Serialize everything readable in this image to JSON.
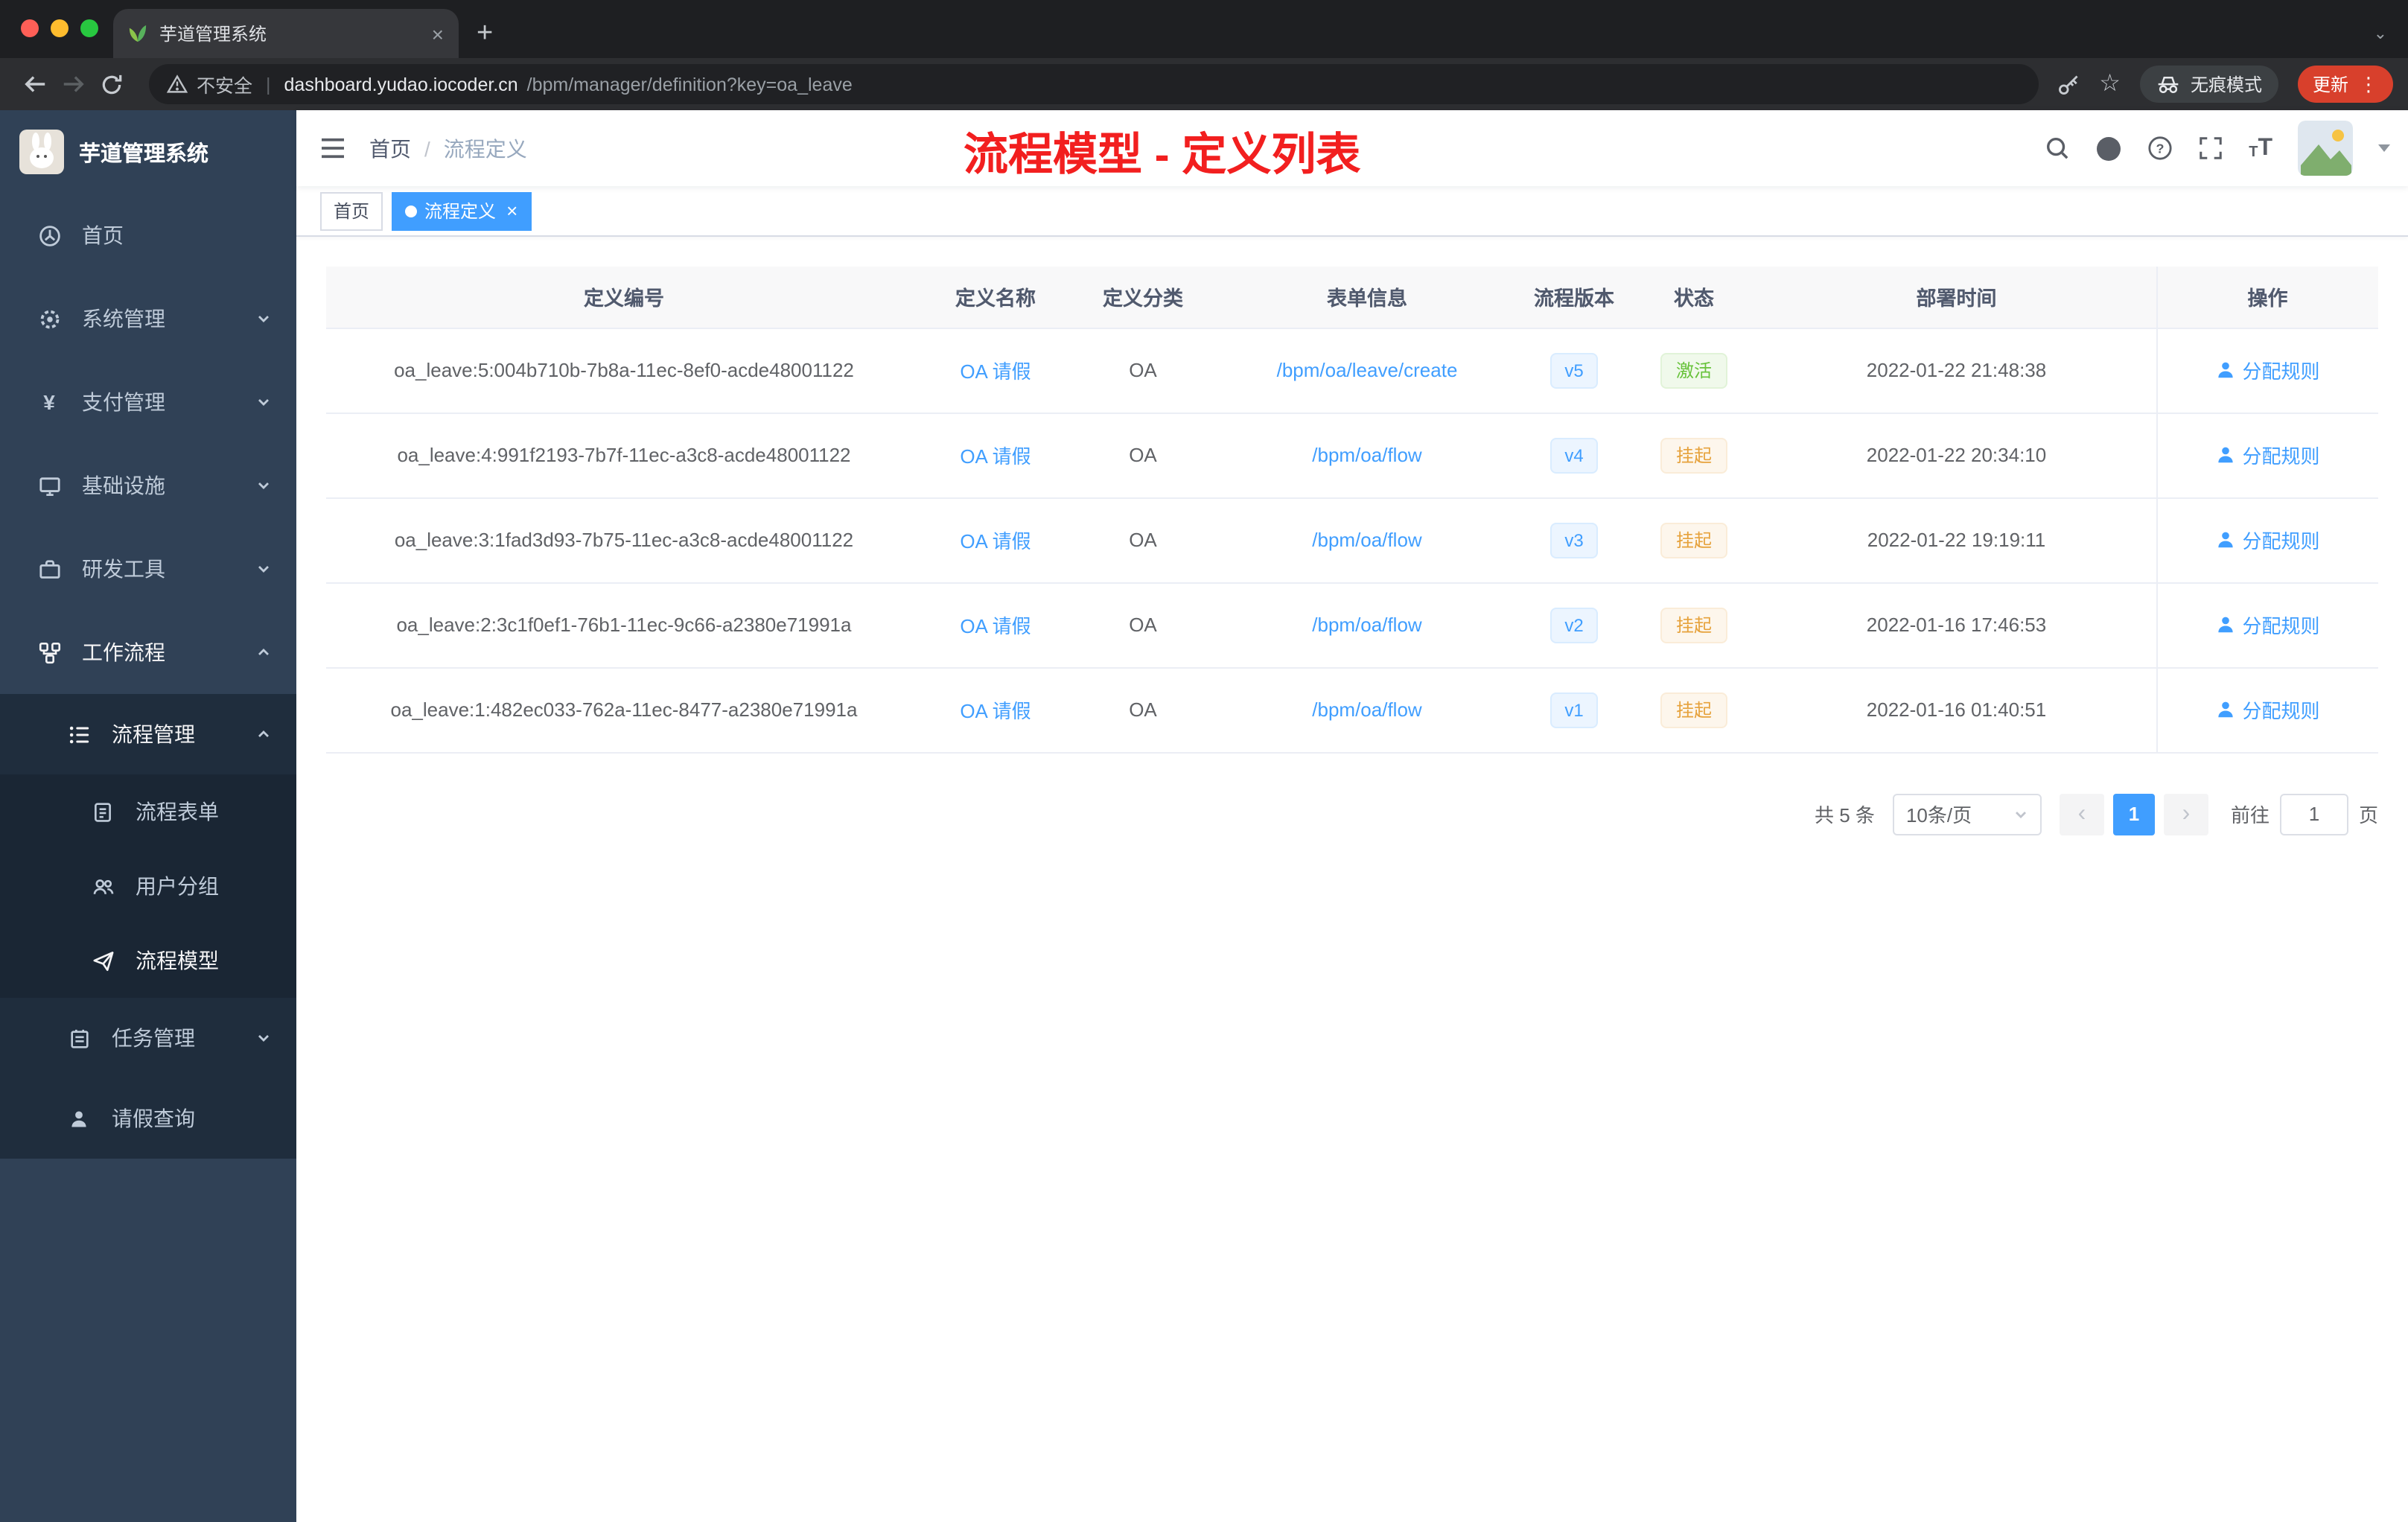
{
  "browser": {
    "tab": {
      "title": "芋道管理系统"
    },
    "toolbar": {
      "security_label": "不安全",
      "url_domain": "dashboard.yudao.iocoder.cn",
      "url_path": "/bpm/manager/definition?key=oa_leave",
      "incognito_label": "无痕模式",
      "update_label": "更新"
    }
  },
  "glyphs": {
    "close": "×",
    "plus": "+",
    "kebab": "⋮",
    "star": "☆",
    "tab_chevron": "⌄",
    "divider": "|",
    "yen": "¥",
    "font_icon": "T",
    "prev": "‹",
    "next": "›"
  },
  "sidebar": {
    "logo": "芋道管理系统",
    "items": [
      {
        "label": "首页"
      },
      {
        "label": "系统管理"
      },
      {
        "label": "支付管理"
      },
      {
        "label": "基础设施"
      },
      {
        "label": "研发工具"
      },
      {
        "label": "工作流程"
      }
    ],
    "workflow": {
      "process_manage": "流程管理",
      "children": [
        {
          "label": "流程表单"
        },
        {
          "label": "用户分组"
        },
        {
          "label": "流程模型"
        }
      ],
      "task_manage": "任务管理",
      "leave_query": "请假查询"
    }
  },
  "navbar": {
    "breadcrumb": [
      "首页",
      "流程定义"
    ],
    "annotation": "流程模型 - 定义列表"
  },
  "tags": [
    {
      "label": "首页",
      "active": false
    },
    {
      "label": "流程定义",
      "active": true
    }
  ],
  "table": {
    "headers": [
      "定义编号",
      "定义名称",
      "定义分类",
      "表单信息",
      "流程版本",
      "状态",
      "部署时间",
      "操作"
    ],
    "action_label": "分配规则",
    "rows": [
      {
        "id": "oa_leave:5:004b710b-7b8a-11ec-8ef0-acde48001122",
        "name": "OA 请假",
        "category": "OA",
        "form": "/bpm/oa/leave/create",
        "version": "v5",
        "status": "激活",
        "deploy_time": "2022-01-22 21:48:38"
      },
      {
        "id": "oa_leave:4:991f2193-7b7f-11ec-a3c8-acde48001122",
        "name": "OA 请假",
        "category": "OA",
        "form": "/bpm/oa/flow",
        "version": "v4",
        "status": "挂起",
        "deploy_time": "2022-01-22 20:34:10"
      },
      {
        "id": "oa_leave:3:1fad3d93-7b75-11ec-a3c8-acde48001122",
        "name": "OA 请假",
        "category": "OA",
        "form": "/bpm/oa/flow",
        "version": "v3",
        "status": "挂起",
        "deploy_time": "2022-01-22 19:19:11"
      },
      {
        "id": "oa_leave:2:3c1f0ef1-76b1-11ec-9c66-a2380e71991a",
        "name": "OA 请假",
        "category": "OA",
        "form": "/bpm/oa/flow",
        "version": "v2",
        "status": "挂起",
        "deploy_time": "2022-01-16 17:46:53"
      },
      {
        "id": "oa_leave:1:482ec033-762a-11ec-8477-a2380e71991a",
        "name": "OA 请假",
        "category": "OA",
        "form": "/bpm/oa/flow",
        "version": "v1",
        "status": "挂起",
        "deploy_time": "2022-01-16 01:40:51"
      }
    ]
  },
  "pagination": {
    "total": "共 5 条",
    "page_size": "10条/页",
    "current_page": "1",
    "goto_label": "前往",
    "goto_value": "1",
    "page_label": "页"
  },
  "colors": {
    "accent": "#409eff",
    "annotation_red": "#f21f1f",
    "status_active_green": "#67c23a",
    "status_suspend_yellow": "#e6a23c",
    "sidebar_bg": "#304156",
    "sidebar_sub_bg": "#1f2d3d"
  }
}
